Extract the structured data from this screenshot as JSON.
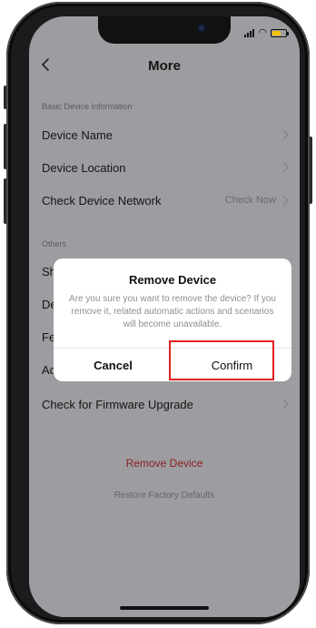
{
  "nav": {
    "title": "More",
    "back_icon": "chevron-left-icon"
  },
  "sections": [
    {
      "header": "Basic Device Information"
    },
    {
      "header": "Others"
    }
  ],
  "rows": [
    {
      "label": "Device Name",
      "value": ""
    },
    {
      "label": "Device Location",
      "value": ""
    },
    {
      "label": "Check Device Network",
      "value": "Check Now"
    },
    {
      "label": "Sh",
      "value": ""
    },
    {
      "label": "De",
      "value": ""
    },
    {
      "label": "Fe",
      "value": ""
    },
    {
      "label": "Ac",
      "value": ""
    },
    {
      "label": "Check for Firmware Upgrade",
      "value": ""
    }
  ],
  "actions": {
    "remove_device": "Remove Device",
    "restore_defaults": "Restore Factory Defaults"
  },
  "dialog": {
    "title": "Remove Device",
    "message": "Are you sure you want to remove the device? If you remove it, related automatic actions and scenarios will become unavailable.",
    "cancel_label": "Cancel",
    "confirm_label": "Confirm"
  },
  "colors": {
    "background": "#efeff4",
    "danger": "#d32f2f",
    "highlight": "#e02020",
    "battery": "#f2c200"
  }
}
